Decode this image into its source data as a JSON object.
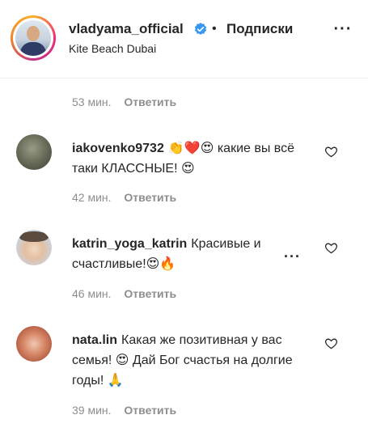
{
  "header": {
    "username": "vladyama_official",
    "separator": "•",
    "follow_label": "Подписки",
    "location": "Kite Beach Dubai",
    "more_label": "···"
  },
  "first_meta": {
    "time": "53 мин.",
    "reply": "Ответить"
  },
  "comments": [
    {
      "username": "iakovenko9732",
      "text": "👏❤️😍 какие вы всё таки КЛАССНЫЕ! 😍",
      "time": "42 мин.",
      "reply": "Ответить"
    },
    {
      "username": "katrin_yoga_katrin",
      "text": "Красивые и счастливые!😍🔥",
      "time": "46 мин.",
      "reply": "Ответить",
      "more_label": "···"
    },
    {
      "username": "nata.lin",
      "text": "Какая же позитивная у вас семья! 😍 Дай Бог счастья на долгие годы! 🙏",
      "time": "39 мин.",
      "reply": "Ответить"
    }
  ],
  "colors": {
    "text": "#262626",
    "meta": "#8e8e8e",
    "verified": "#3897f0",
    "divider": "#efefef"
  },
  "icons": {
    "verified": "verified-badge-icon",
    "like": "heart-outline-icon",
    "more": "more-horizontal-icon"
  }
}
